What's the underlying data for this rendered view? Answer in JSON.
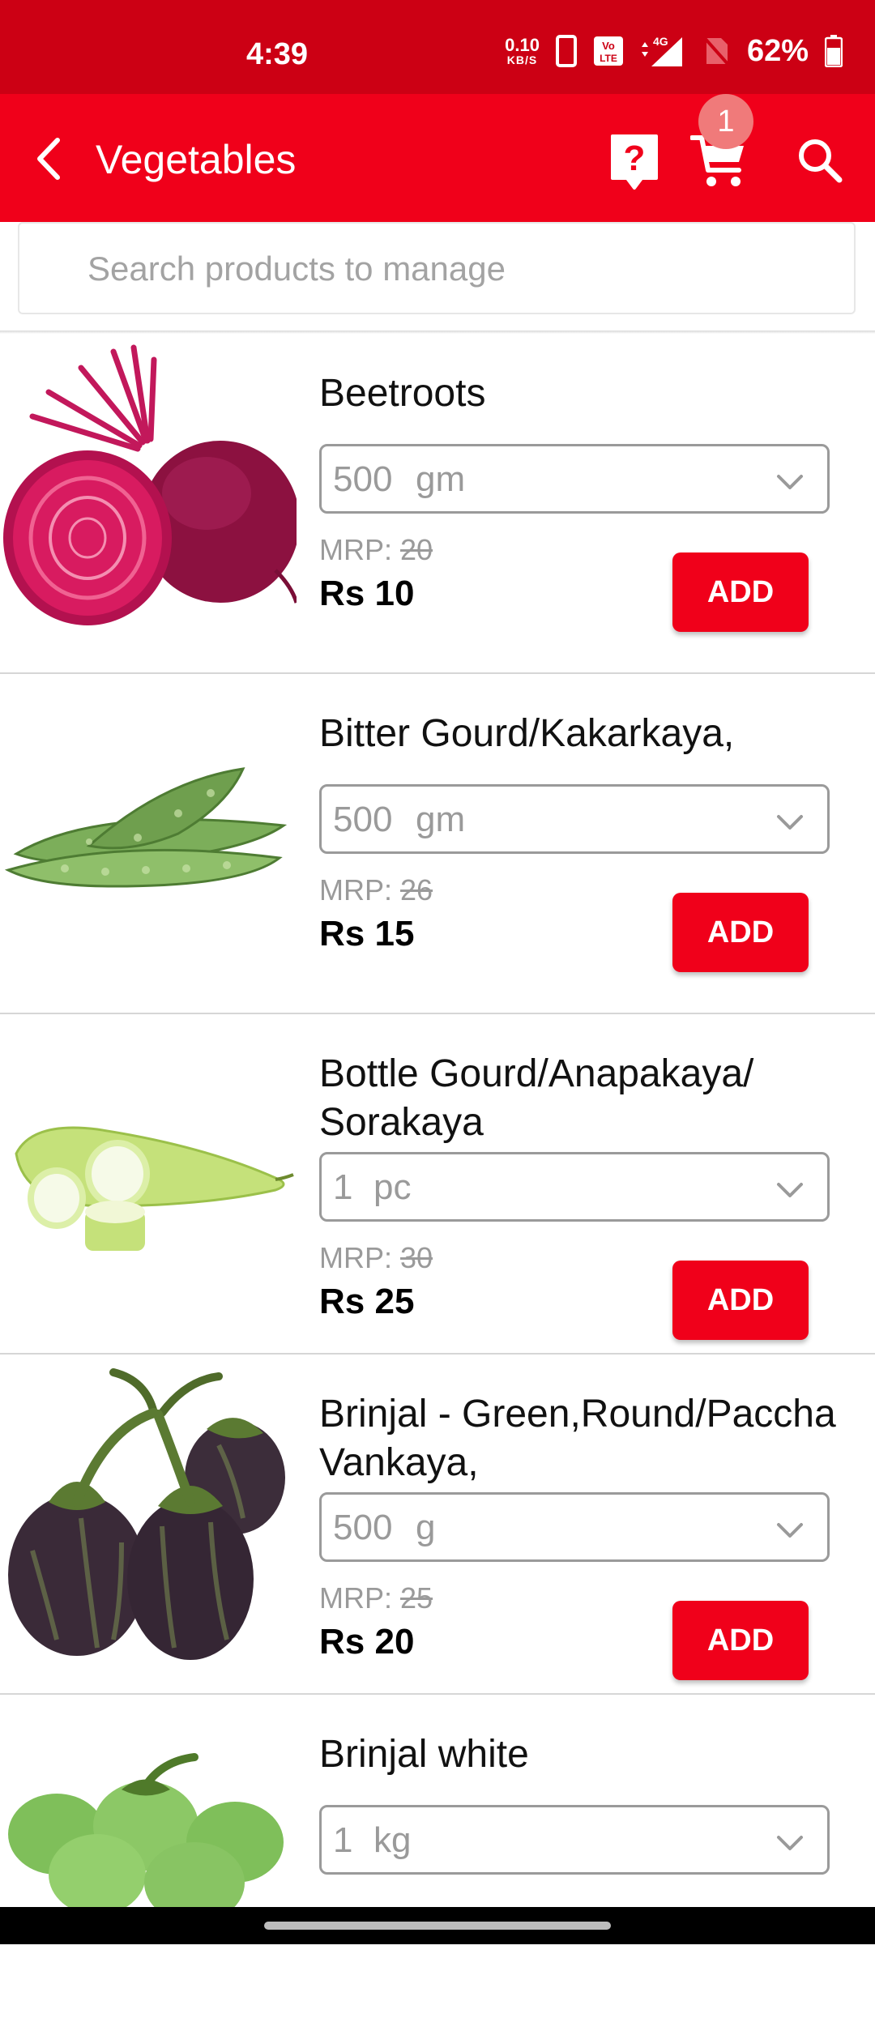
{
  "status_bar": {
    "time": "4:39",
    "net_speed": "0.10",
    "net_unit": "KB/S",
    "battery": "62%",
    "icons": [
      "phone-icon",
      "volte-icon",
      "signal-4g-icon",
      "no-sim-icon",
      "battery-icon"
    ]
  },
  "app_bar": {
    "title": "Vegetables",
    "cart_count": "1",
    "icons": [
      "back-arrow-icon",
      "help-icon",
      "cart-icon",
      "search-icon"
    ]
  },
  "search": {
    "placeholder": "Search products to manage",
    "value": ""
  },
  "products": [
    {
      "name": "Beetroots",
      "qty": "500",
      "unit": "gm",
      "mrp_label": "MRP: ",
      "mrp": "20",
      "price": "Rs 10",
      "add_label": "ADD"
    },
    {
      "name": "Bitter Gourd/Kakarkaya,",
      "qty": "500",
      "unit": "gm",
      "mrp_label": "MRP: ",
      "mrp": "26",
      "price": "Rs 15",
      "add_label": "ADD"
    },
    {
      "name": "Bottle Gourd/Anapakaya/ Sorakaya",
      "qty": "1",
      "unit": "pc",
      "mrp_label": "MRP: ",
      "mrp": "30",
      "price": "Rs 25",
      "add_label": "ADD"
    },
    {
      "name": "Brinjal - Green,Round/Paccha Vankaya,",
      "qty": "500",
      "unit": "g",
      "mrp_label": "MRP: ",
      "mrp": "25",
      "price": "Rs 20",
      "add_label": "ADD"
    },
    {
      "name": "Brinjal white",
      "qty": "1",
      "unit": "kg"
    }
  ],
  "colors": {
    "brand_red": "#f0001a",
    "status_red": "#cc0014",
    "badge": "#f07a7a"
  }
}
